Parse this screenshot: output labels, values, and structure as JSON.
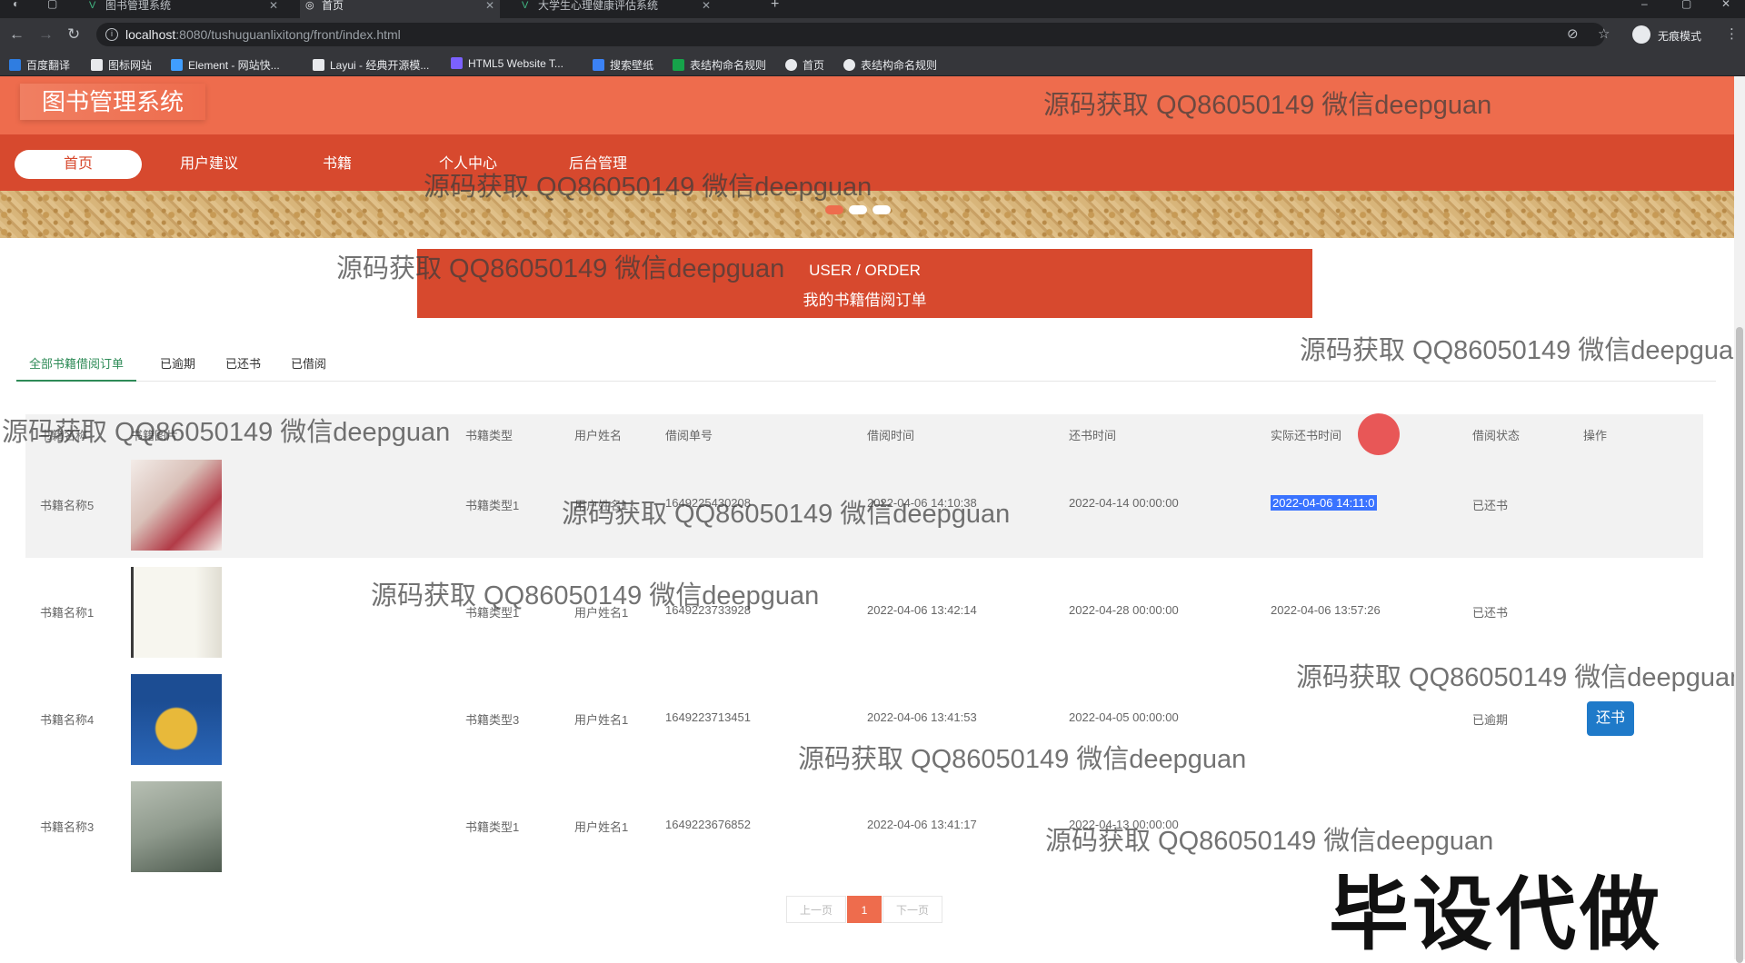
{
  "browser": {
    "tabs": [
      {
        "title": "图书管理系统",
        "active": false
      },
      {
        "title": "首页",
        "active": true
      },
      {
        "title": "大学生心理健康评估系统",
        "active": false
      }
    ],
    "url_host": "localhost",
    "url_path": ":8080/tushuguanlixitong/front/index.html",
    "incognito_label": "无痕模式",
    "bookmarks": [
      {
        "label": "百度翻译",
        "color": "#2f7de1"
      },
      {
        "label": "图标网站",
        "color": "#e8eaed"
      },
      {
        "label": "Element - 网站快...",
        "color": "#409eff"
      },
      {
        "label": "Layui - 经典开源模...",
        "color": "#e8eaed"
      },
      {
        "label": "HTML5 Website T...",
        "color": "#7b61ff"
      },
      {
        "label": "搜索壁纸",
        "color": "#3b82f6"
      },
      {
        "label": "表结构命名规则",
        "color": "#16a34a"
      },
      {
        "label": "首页",
        "color": "#e8eaed"
      },
      {
        "label": "表结构命名规则",
        "color": "#e8eaed"
      }
    ]
  },
  "site": {
    "logo": "图书管理系统",
    "nav": [
      {
        "label": "首页",
        "active": true
      },
      {
        "label": "用户建议",
        "active": false
      },
      {
        "label": "书籍",
        "active": false
      },
      {
        "label": "个人中心",
        "active": false
      },
      {
        "label": "后台管理",
        "active": false
      }
    ],
    "primary_color": "#ee6c4d",
    "nav_color": "#d7492e"
  },
  "order_header": {
    "subtitle": "USER / ORDER",
    "title": "我的书籍借阅订单"
  },
  "order_tabs": [
    {
      "label": "全部书籍借阅订单",
      "active": true
    },
    {
      "label": "已逾期",
      "active": false
    },
    {
      "label": "已还书",
      "active": false
    },
    {
      "label": "已借阅",
      "active": false
    }
  ],
  "table": {
    "headers": [
      "书籍名称",
      "书籍图片",
      "书籍类型",
      "用户姓名",
      "借阅单号",
      "借阅时间",
      "还书时间",
      "实际还书时间",
      "借阅状态",
      "操作"
    ],
    "rows": [
      {
        "name": "书籍名称5",
        "type": "书籍类型1",
        "user": "用户姓名1",
        "order_no": "1649225430208",
        "borrow_time": "2022-04-06 14:10:38",
        "due_time": "2022-04-14 00:00:00",
        "actual_return": "2022-04-06 14:11:0",
        "status": "已还书",
        "action": "",
        "img_colors": [
          "#f3ece8",
          "#b23b47"
        ]
      },
      {
        "name": "书籍名称1",
        "type": "书籍类型1",
        "user": "用户姓名1",
        "order_no": "1649223733928",
        "borrow_time": "2022-04-06 13:42:14",
        "due_time": "2022-04-28 00:00:00",
        "actual_return": "2022-04-06 13:57:26",
        "status": "已还书",
        "action": "",
        "img_colors": [
          "#f7f6ef",
          "#3a3a3a"
        ]
      },
      {
        "name": "书籍名称4",
        "type": "书籍类型3",
        "user": "用户姓名1",
        "order_no": "1649223713451",
        "borrow_time": "2022-04-06 13:41:53",
        "due_time": "2022-04-05 00:00:00",
        "actual_return": "",
        "status": "已逾期",
        "action": "还书",
        "img_colors": [
          "#1c4d93",
          "#e8b93a"
        ]
      },
      {
        "name": "书籍名称3",
        "type": "书籍类型1",
        "user": "用户姓名1",
        "order_no": "1649223676852",
        "borrow_time": "2022-04-06 13:41:17",
        "due_time": "2022-04-13 00:00:00",
        "actual_return": "",
        "status": "",
        "action": "",
        "img_colors": [
          "#9aa39a",
          "#4d5a4e"
        ]
      }
    ]
  },
  "pager": {
    "prev": "上一页",
    "current": "1",
    "next": "下一页"
  },
  "watermark": "源码获取 QQ86050149 微信deepguan",
  "big_watermark": "毕设代做"
}
